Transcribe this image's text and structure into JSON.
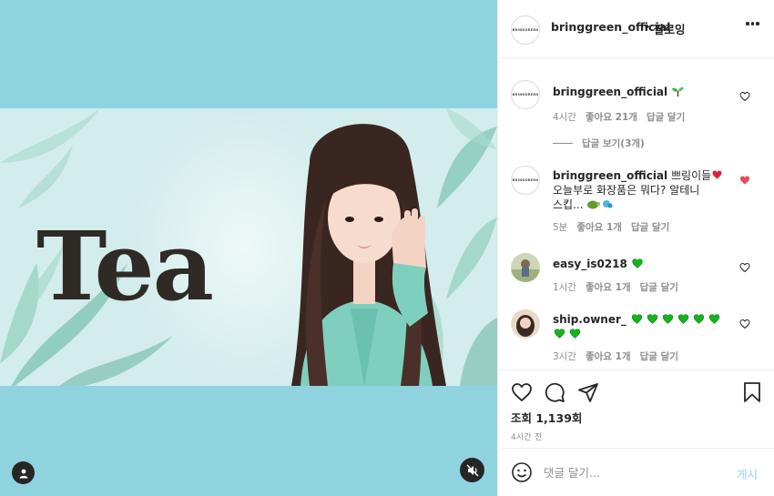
{
  "post": {
    "author": "bringgreen_official",
    "separator": "•",
    "follow_label": "팔로잉",
    "logo_text": "BRINGGREEN",
    "media_title": "Tea",
    "views_text": "조회 1,139회",
    "time_ago": "4시간 전"
  },
  "comments": [
    {
      "user": "bringgreen_official",
      "text": "",
      "emoji": "sprout",
      "time": "4시간",
      "likes": "좋아요 21개",
      "reply": "답글 달기",
      "liked": false,
      "view_replies": "답글 보기(3개)"
    },
    {
      "user": "bringgreen_official",
      "text": "쁘링이들",
      "text_line2": "오늘부로 화장품은 뭐다? 알테니",
      "text_line3": "스킵...",
      "time": "5분",
      "likes": "좋아요 1개",
      "reply": "답글 달기",
      "liked": true
    },
    {
      "user": "easy_is0218",
      "time": "1시간",
      "likes": "좋아요 1개",
      "reply": "답글 달기",
      "liked": false,
      "green_hearts": 1
    },
    {
      "user": "ship.owner_",
      "time": "3시간",
      "likes": "좋아요 1개",
      "reply": "답글 달기",
      "liked": false,
      "green_hearts": 8
    }
  ],
  "composer": {
    "placeholder": "댓글 달기...",
    "post_label": "게시"
  },
  "colors": {
    "media_bg": "#8fd3de",
    "like_red": "#ed4956",
    "green_heart": "#17b31f",
    "post_blue_disabled": "#b2dffc"
  },
  "icons": [
    "user-tag-icon",
    "mute-icon",
    "more-icon",
    "heart-icon",
    "comment-icon",
    "share-icon",
    "bookmark-icon",
    "emoji-icon"
  ]
}
